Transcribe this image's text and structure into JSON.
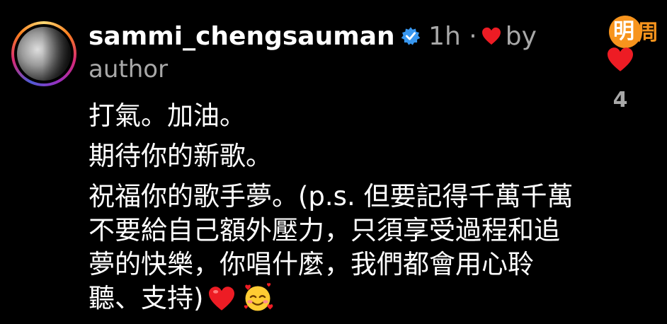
{
  "colors": {
    "background": "#000000",
    "text": "#ffffff",
    "muted": "#a8a8a8",
    "verified": "#3897f0",
    "heart": "#ed1c24",
    "logo_orange": "#f7941d"
  },
  "comment": {
    "username": "sammi_chengsauman",
    "time": "1h",
    "separator": "·",
    "liked_by": "by",
    "author": "author",
    "lines": [
      "打氣。加油。",
      "期待你的新歌。",
      "祝福你的歌手夢。(p.s. 但要記得千萬千萬不要給自己額外壓力，只須享受過程和追夢的快樂，你唱什麼，我們都會用心聆聽、支持)"
    ],
    "emojis": [
      "red-heart",
      "smiling-face-with-hearts"
    ]
  },
  "likes": {
    "count": "4",
    "icon": "heart-icon"
  },
  "watermark": {
    "char1": "明",
    "char2": "周"
  }
}
